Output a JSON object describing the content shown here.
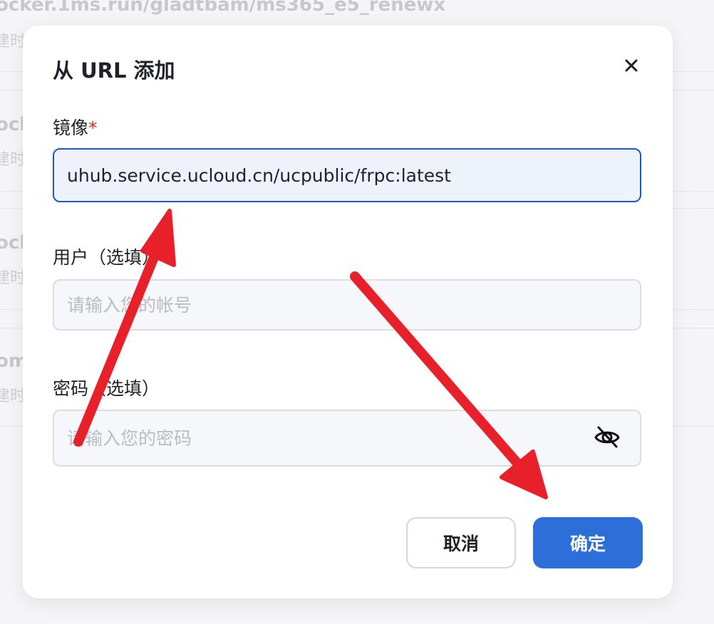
{
  "background": {
    "items": [
      {
        "title": "ocker.1ms.run/gladtbam/ms365_e5_renewx",
        "sub": "建时"
      },
      {
        "title": "ock",
        "sub": "建时"
      },
      {
        "title": "ock",
        "sub": "建时"
      },
      {
        "title": "om",
        "sub": "建时"
      }
    ]
  },
  "modal": {
    "title": "从 URL 添加",
    "image_field": {
      "label": "镜像",
      "required_mark": "*",
      "value": "uhub.service.ucloud.cn/ucpublic/frpc:latest"
    },
    "user_field": {
      "label": "用户（选填）",
      "placeholder": "请输入您的帐号",
      "value": ""
    },
    "password_field": {
      "label": "密码（选填）",
      "placeholder": "请输入您的密码",
      "value": ""
    },
    "buttons": {
      "cancel": "取消",
      "ok": "确定"
    }
  },
  "colors": {
    "accent": "#2d6fd9",
    "focus_border": "#1f57c3",
    "required": "#e02424",
    "annotation_arrow": "#e8202a"
  },
  "icons": {
    "close": "close-icon",
    "password_visibility": "eye-slash-icon"
  }
}
